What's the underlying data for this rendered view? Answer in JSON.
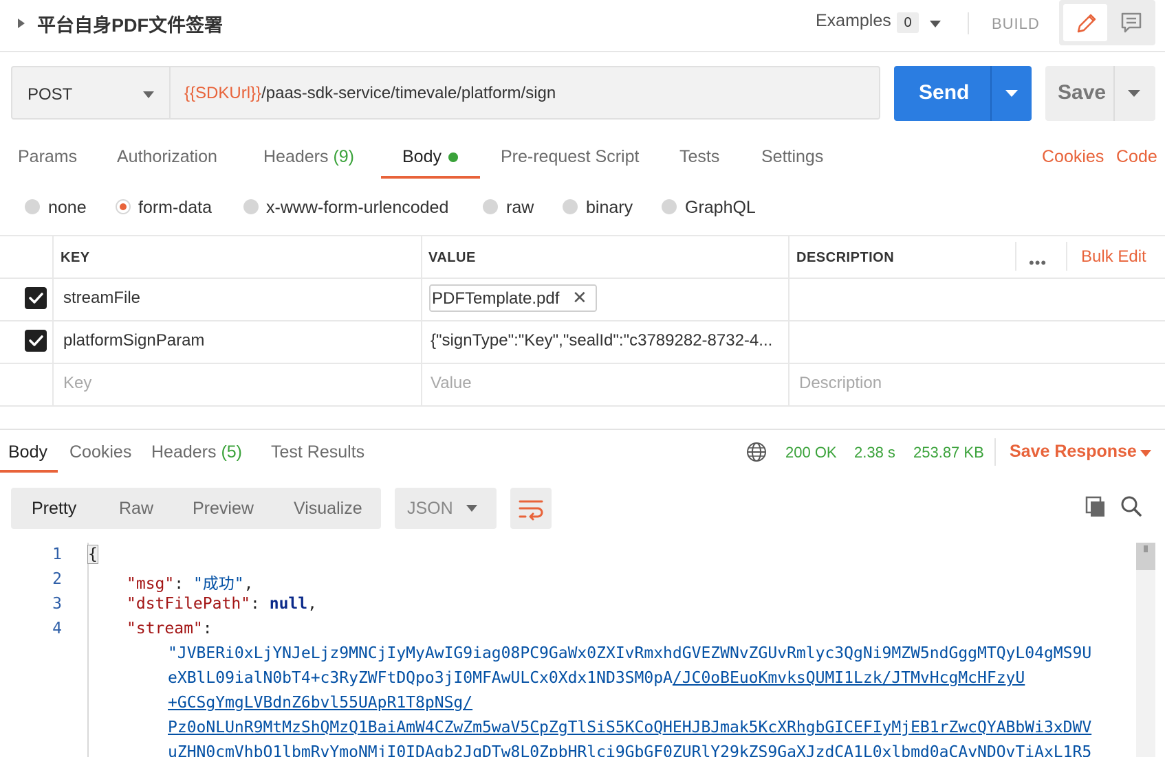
{
  "header": {
    "request_title": "平台自身PDF文件签署",
    "examples_label": "Examples",
    "examples_count": "0",
    "build_label": "BUILD",
    "icons": {
      "collapse": "caret-right-icon",
      "edit": "pencil-icon",
      "comment": "comment-icon"
    }
  },
  "request": {
    "method": "POST",
    "url_variable": "{{SDKUrl}}",
    "url_path": "/paas-sdk-service/timevale/platform/sign",
    "send_label": "Send",
    "save_label": "Save"
  },
  "request_tabs": [
    {
      "label": "Params"
    },
    {
      "label": "Authorization"
    },
    {
      "label": "Headers",
      "count": "(9)"
    },
    {
      "label": "Body",
      "active": true
    },
    {
      "label": "Pre-request Script"
    },
    {
      "label": "Tests"
    },
    {
      "label": "Settings"
    }
  ],
  "request_links": {
    "cookies": "Cookies",
    "code": "Code"
  },
  "body_types": [
    {
      "label": "none"
    },
    {
      "label": "form-data",
      "selected": true
    },
    {
      "label": "x-www-form-urlencoded"
    },
    {
      "label": "raw"
    },
    {
      "label": "binary"
    },
    {
      "label": "GraphQL"
    }
  ],
  "form_table": {
    "headers": {
      "key": "KEY",
      "value": "VALUE",
      "description": "DESCRIPTION"
    },
    "more_options": "•••",
    "bulk_edit": "Bulk Edit",
    "rows": [
      {
        "checked": true,
        "key": "streamFile",
        "value": "PDFTemplate.pdf",
        "value_type": "file"
      },
      {
        "checked": true,
        "key": "platformSignParam",
        "value": "{\"signType\":\"Key\",\"sealId\":\"c3789282-8732-4..."
      }
    ],
    "placeholders": {
      "key": "Key",
      "value": "Value",
      "description": "Description"
    }
  },
  "response": {
    "tabs": [
      {
        "label": "Body",
        "active": true
      },
      {
        "label": "Cookies"
      },
      {
        "label": "Headers",
        "count": "(5)"
      },
      {
        "label": "Test Results"
      }
    ],
    "status": "200 OK",
    "time": "2.38 s",
    "size": "253.87 KB",
    "save_response": "Save Response",
    "view_modes": [
      "Pretty",
      "Raw",
      "Preview",
      "Visualize"
    ],
    "format": "JSON",
    "colors": {
      "accent": "#e8633a",
      "primary": "#2b7de1",
      "success": "#3aa23a"
    }
  },
  "code": {
    "line_numbers": [
      "1",
      "2",
      "3",
      "4"
    ],
    "open_brace": "{",
    "msg_key": "\"msg\"",
    "msg_value": "\"成功\"",
    "dst_key": "\"dstFilePath\"",
    "dst_value": "null",
    "stream_key": "\"stream\"",
    "stream_lines": [
      "\"JVBERi0xLjYNJeLjz9MNCjIyMyAwIG9iag08PC9GaWx0ZXIvRmxhdGVEZWNvZGUvRmlyc3QgNi9MZW5ndGggMTQyL04gMS9U",
      "eXBlL09ialN0bT4+c3RyZWFtDQpo3jI0MFAwULCx0Xdx1ND3SM0pA",
      "+GCSgYmgLVBdnZ6bvl55UApR1T8pNSg/",
      "Pz0oNLUnR9MtMzShQMzQ1BaiAmW4CZwZm5waV5CpZgTlSiS5KCoQHEHJBJmak5KcXRhgbGICEFIyMjEB1rZwcQYABbWi3xDWV",
      "uZHN0cmVhbQ1lbmRvYmoNMjI0IDAgb2JqDTw8L0ZpbHRlci9GbGF0ZURlY29kZS9GaXJzdCA1L0xlbmd0aCAyNDQvTiAxL1R5"
    ],
    "stream_line2_link": "/JC0oBEuoKmvksQUMI1Lzk/JTMvHcgMcHFzyU"
  }
}
